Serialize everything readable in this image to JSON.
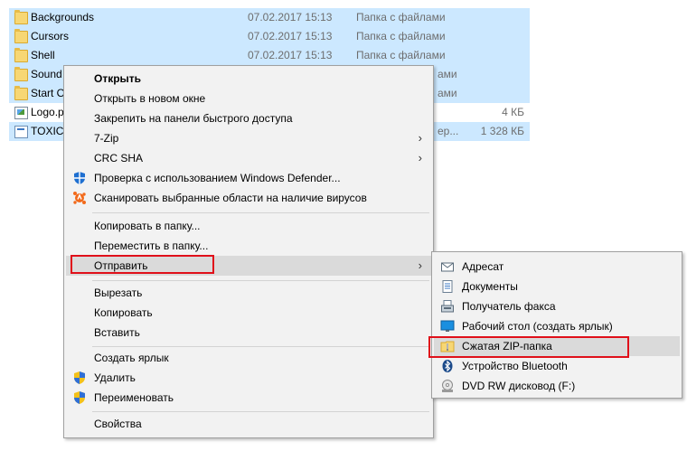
{
  "files": [
    {
      "name": "Backgrounds",
      "date": "07.02.2017 15:13",
      "type": "Папка с файлами",
      "size": "",
      "icon": "folder-icon",
      "selected": true
    },
    {
      "name": "Cursors",
      "date": "07.02.2017 15:13",
      "type": "Папка с файлами",
      "size": "",
      "icon": "folder-icon",
      "selected": true
    },
    {
      "name": "Shell",
      "date": "07.02.2017 15:13",
      "type": "Папка с файлами",
      "size": "",
      "icon": "folder-icon",
      "selected": true
    },
    {
      "name": "Sound",
      "date": "",
      "type": "ами",
      "size": "",
      "icon": "folder-icon",
      "selected": true
    },
    {
      "name": "Start O",
      "date": "",
      "type": "ами",
      "size": "",
      "icon": "folder-icon",
      "selected": true
    },
    {
      "name": "Logo.p",
      "date": "",
      "type": "",
      "size": "4 КБ",
      "icon": "image-icon",
      "selected": false
    },
    {
      "name": "TOXIC",
      "date": "",
      "type": "ер...",
      "size": "1 328 КБ",
      "icon": "document-icon",
      "selected": true
    }
  ],
  "context_menu": {
    "open": "Открыть",
    "open_new_window": "Открыть в новом окне",
    "pin_quick_access": "Закрепить на панели быстрого доступа",
    "sevenzip": "7-Zip",
    "crc_sha": "CRC SHA",
    "defender_scan": "Проверка с использованием Windows Defender...",
    "avast_scan": "Сканировать выбранные области на наличие вирусов",
    "copy_to_folder": "Копировать в папку...",
    "move_to_folder": "Переместить в папку...",
    "send_to": "Отправить",
    "cut": "Вырезать",
    "copy": "Копировать",
    "paste": "Вставить",
    "create_shortcut": "Создать ярлык",
    "delete": "Удалить",
    "rename": "Переименовать",
    "properties": "Свойства"
  },
  "sendto_menu": {
    "recipient": "Адресат",
    "documents": "Документы",
    "fax_recipient": "Получатель факса",
    "desktop_shortcut": "Рабочий стол (создать ярлык)",
    "zip_folder": "Сжатая ZIP-папка",
    "bluetooth": "Устройство Bluetooth",
    "dvd_drive": "DVD RW дисковод (F:)"
  },
  "colors": {
    "selection": "#cce8ff",
    "menu_bg": "#f2f2f2",
    "menu_hover": "#dadada",
    "highlight_frame": "#e0101a"
  }
}
